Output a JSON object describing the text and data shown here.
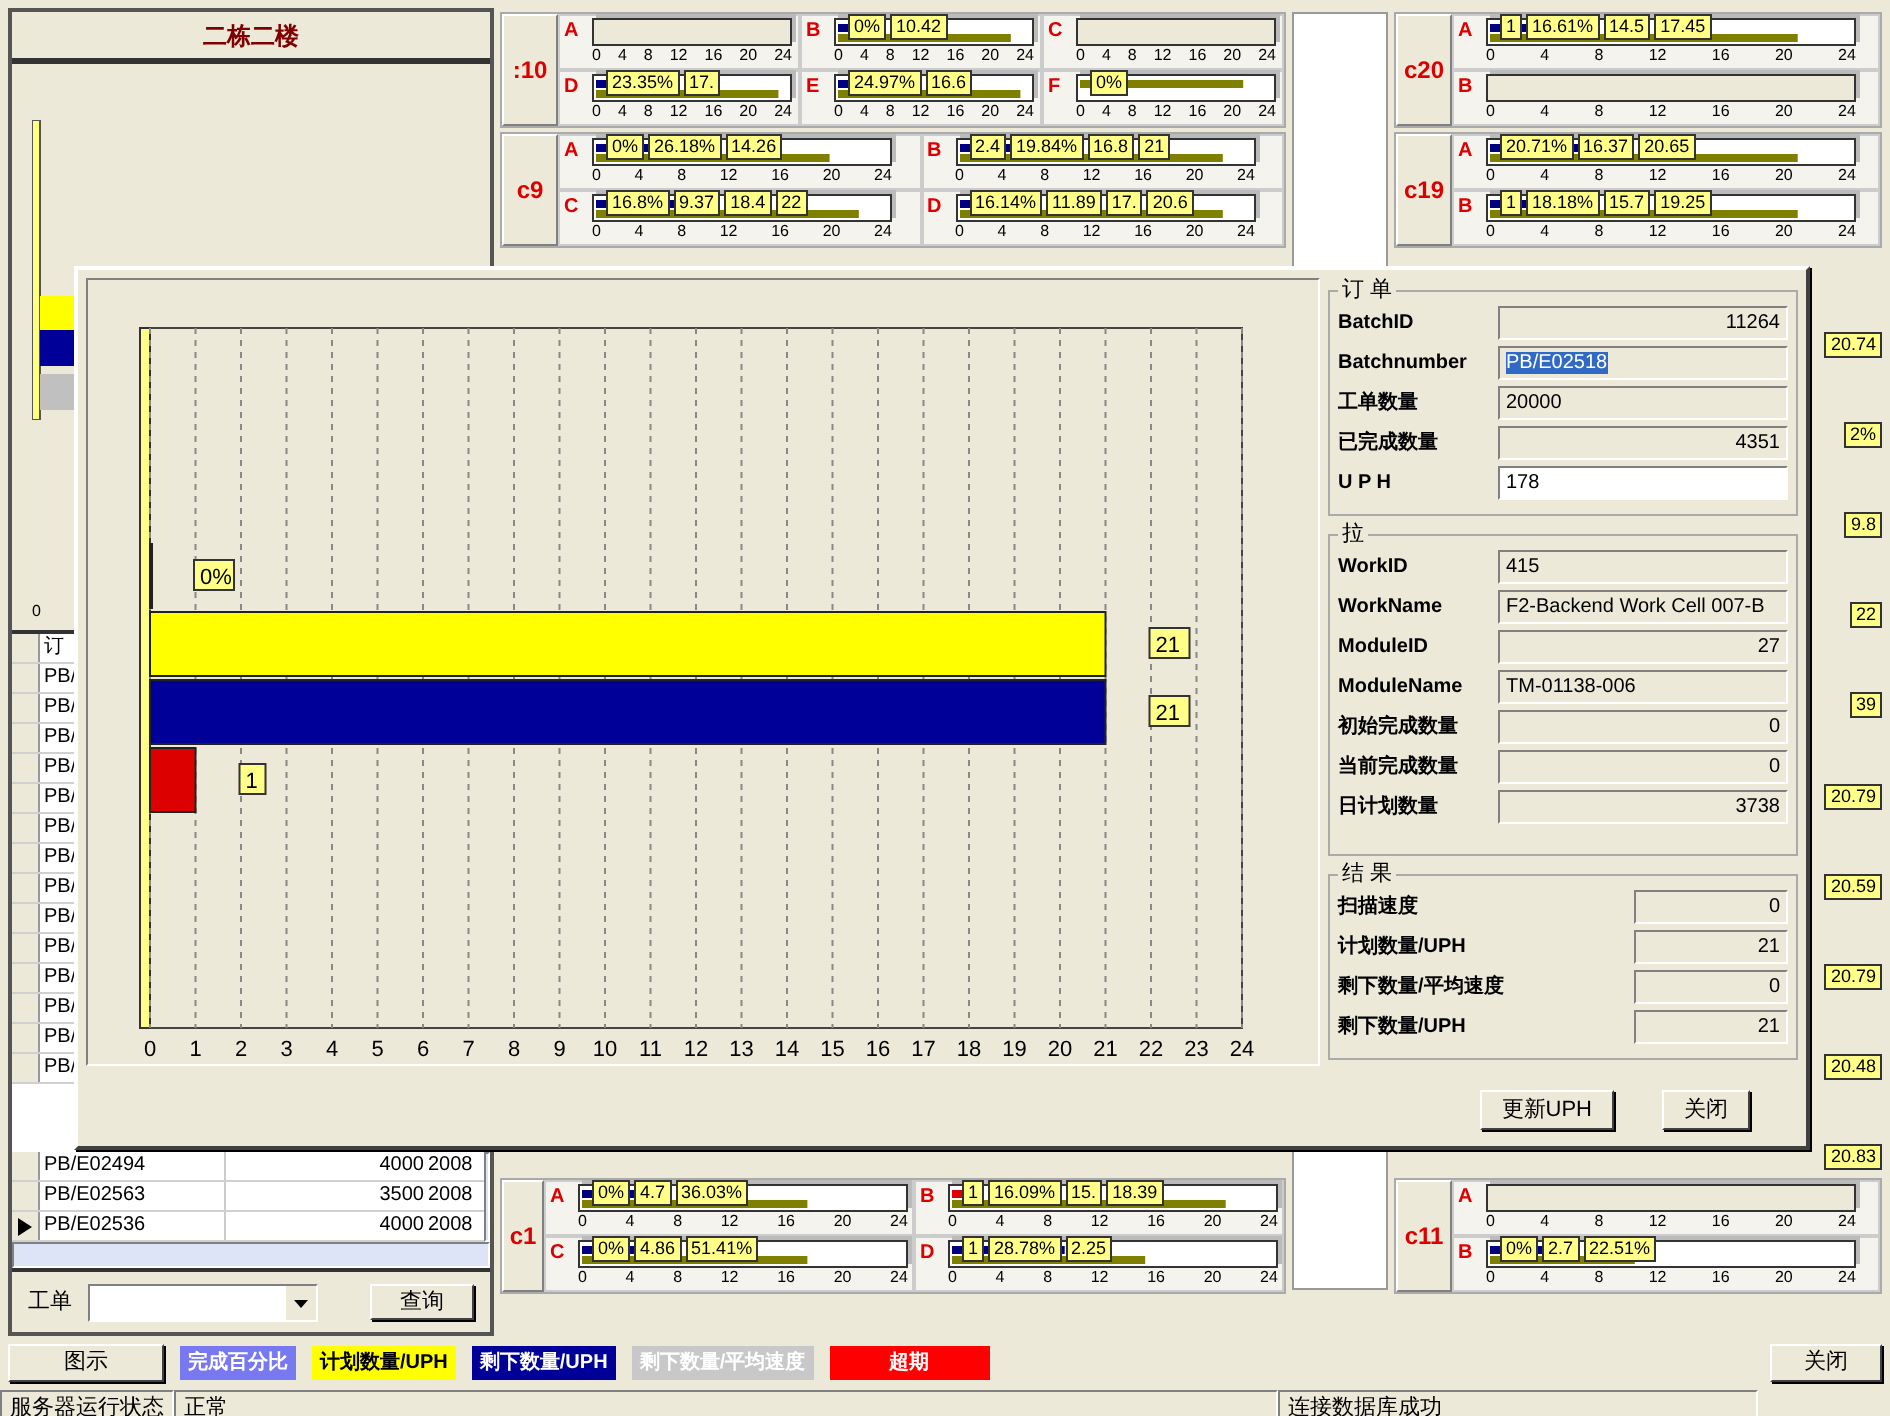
{
  "left_panel": {
    "title": "二栋二楼",
    "chart_tick": "0",
    "table": {
      "header": "订",
      "covered_rows": [
        "PB/",
        "PB/",
        "PB/",
        "PB/",
        "PB/",
        "PB/",
        "PB/",
        "PB/",
        "PB/",
        "PB/",
        "PB/",
        "PB/",
        "PB/",
        "PB/"
      ],
      "rows": [
        {
          "order": "PB/E02494",
          "qty": "4000",
          "date": "2008",
          "selected": false
        },
        {
          "order": "PB/E02563",
          "qty": "3500",
          "date": "2008",
          "selected": false
        },
        {
          "order": "PB/E02536",
          "qty": "4000",
          "date": "2008",
          "selected": true
        }
      ]
    },
    "query": {
      "label": "工单",
      "button": "查询"
    }
  },
  "middle_top": [
    {
      "name": ":10",
      "rows": [
        [
          {
            "letter": "A",
            "ticks": [
              "0",
              "4",
              "8",
              "12",
              "16",
              "20",
              "24"
            ]
          },
          {
            "letter": "B",
            "bars": [
              {
                "color": "#000080",
                "level": 0.25
              },
              {
                "color": "#808000",
                "level": 0.9
              }
            ],
            "labels": [
              "0%",
              "10.42"
            ],
            "ticks": [
              "0",
              "4",
              "8",
              "12",
              "16",
              "20",
              "24"
            ]
          },
          {
            "letter": "C",
            "ticks": [
              "0",
              "4",
              "8",
              "12",
              "16",
              "20",
              "24"
            ]
          }
        ],
        [
          {
            "letter": "D",
            "bars": [
              {
                "color": "#000080",
                "level": 0.35
              },
              {
                "color": "#808000",
                "level": 0.95
              }
            ],
            "labels": [
              "23.35%",
              "17."
            ],
            "ticks": [
              "0",
              "4",
              "8",
              "12",
              "16",
              "20",
              "24"
            ]
          },
          {
            "letter": "E",
            "bars": [
              {
                "color": "#000080",
                "level": 0.4
              },
              {
                "color": "#808000",
                "level": 0.95
              }
            ],
            "labels": [
              "24.97%",
              "16.6"
            ],
            "ticks": [
              "0",
              "4",
              "8",
              "12",
              "16",
              "20",
              "24"
            ]
          },
          {
            "letter": "F",
            "bars": [
              {
                "color": "#808000",
                "level": 0.85
              }
            ],
            "labels": [
              "0%"
            ],
            "ticks": [
              "0",
              "4",
              "8",
              "12",
              "16",
              "20",
              "24"
            ]
          }
        ]
      ]
    },
    {
      "name": "c9",
      "rows": [
        [
          {
            "letter": "A",
            "bars": [
              {
                "color": "#000080",
                "level": 0.2
              },
              {
                "color": "#808000",
                "level": 0.8
              }
            ],
            "labels": [
              "0%",
              "26.18%",
              "14.26"
            ],
            "ticks": [
              "0",
              "4",
              "8",
              "12",
              "16",
              "20",
              "24"
            ]
          },
          {
            "letter": "B",
            "bars": [
              {
                "color": "#000080",
                "level": 0.3
              },
              {
                "color": "#808000",
                "level": 0.9
              }
            ],
            "labels": [
              "2.4",
              "19.84%",
              "16.8",
              "21"
            ],
            "ticks": [
              "0",
              "4",
              "8",
              "12",
              "16",
              "20",
              "24"
            ]
          }
        ],
        [
          {
            "letter": "C",
            "bars": [
              {
                "color": "#000080",
                "level": 0.3
              },
              {
                "color": "#808000",
                "level": 0.9
              }
            ],
            "labels": [
              "16.8%",
              "9.37",
              "18.4",
              "22"
            ],
            "ticks": [
              "0",
              "4",
              "8",
              "12",
              "16",
              "20",
              "24"
            ]
          },
          {
            "letter": "D",
            "bars": [
              {
                "color": "#000080",
                "level": 0.25
              },
              {
                "color": "#808000",
                "level": 0.9
              }
            ],
            "labels": [
              "16.14%",
              "11.89",
              "17.",
              "20.6"
            ],
            "ticks": [
              "0",
              "4",
              "8",
              "12",
              "16",
              "20",
              "24"
            ]
          }
        ]
      ]
    }
  ],
  "middle_bottom": [
    {
      "name": "c1",
      "rows": [
        [
          {
            "letter": "A",
            "bars": [
              {
                "color": "#000080",
                "level": 0.2
              },
              {
                "color": "#808000",
                "level": 0.7
              }
            ],
            "labels": [
              "0%",
              "4.7",
              "36.03%"
            ],
            "ticks": [
              "0",
              "4",
              "8",
              "12",
              "16",
              "20",
              "24"
            ]
          },
          {
            "letter": "B",
            "bars": [
              {
                "color": "#dd0000",
                "level": 0.05
              },
              {
                "color": "#808000",
                "level": 0.85
              }
            ],
            "labels": [
              "1",
              "16.09%",
              "15.",
              "18.39"
            ],
            "ticks": [
              "0",
              "4",
              "8",
              "12",
              "16",
              "20",
              "24"
            ]
          }
        ],
        [
          {
            "letter": "C",
            "bars": [
              {
                "color": "#000080",
                "level": 0.2
              },
              {
                "color": "#808000",
                "level": 0.7
              }
            ],
            "labels": [
              "0%",
              "4.86",
              "51.41%"
            ],
            "ticks": [
              "0",
              "4",
              "8",
              "12",
              "16",
              "20",
              "24"
            ]
          },
          {
            "letter": "D",
            "bars": [
              {
                "color": "#000080",
                "level": 0.35
              },
              {
                "color": "#808000",
                "level": 0.6
              }
            ],
            "labels": [
              "1",
              "28.78%",
              "2.25"
            ],
            "ticks": [
              "0",
              "4",
              "8",
              "12",
              "16",
              "20",
              "24"
            ]
          }
        ]
      ]
    }
  ],
  "right_top": [
    {
      "name": "c20",
      "rows": [
        [
          {
            "letter": "A",
            "bars": [
              {
                "color": "#000080",
                "level": 0.3
              },
              {
                "color": "#808000",
                "level": 0.85
              }
            ],
            "labels": [
              "1",
              "16.61%",
              "14.5",
              "17.45"
            ],
            "ticks": [
              "0",
              "4",
              "8",
              "12",
              "16",
              "20",
              "24"
            ]
          }
        ],
        [
          {
            "letter": "B",
            "ticks": [
              "0",
              "4",
              "8",
              "12",
              "16",
              "20",
              "24"
            ]
          }
        ]
      ]
    },
    {
      "name": "c19",
      "rows": [
        [
          {
            "letter": "A",
            "bars": [
              {
                "color": "#000080",
                "level": 0.35
              },
              {
                "color": "#808000",
                "level": 0.85
              }
            ],
            "labels": [
              "20.71%",
              "16.37",
              "20.65"
            ],
            "ticks": [
              "0",
              "4",
              "8",
              "12",
              "16",
              "20",
              "24"
            ]
          }
        ],
        [
          {
            "letter": "B",
            "bars": [
              {
                "color": "#000080",
                "level": 0.3
              },
              {
                "color": "#808000",
                "level": 0.85
              }
            ],
            "labels": [
              "1",
              "18.18%",
              "15.7",
              "19.25"
            ],
            "ticks": [
              "0",
              "4",
              "8",
              "12",
              "16",
              "20",
              "24"
            ]
          }
        ]
      ]
    }
  ],
  "right_strip": [
    "20.74",
    "2%",
    "9.8",
    "22",
    "39",
    "20.79",
    "20.59",
    "20.79",
    "20.48",
    "20.83"
  ],
  "right_bottom": [
    {
      "name": "c11",
      "rows": [
        [
          {
            "letter": "A",
            "ticks": [
              "0",
              "4",
              "8",
              "12",
              "16",
              "20",
              "24"
            ]
          }
        ],
        [
          {
            "letter": "B",
            "bars": [
              {
                "color": "#000080",
                "level": 0.2
              },
              {
                "color": "#808000",
                "level": 0.4
              }
            ],
            "labels": [
              "0%",
              "2.7",
              "22.51%"
            ],
            "ticks": [
              "0",
              "4",
              "8",
              "12",
              "16",
              "20",
              "24"
            ]
          }
        ]
      ]
    }
  ],
  "dialog": {
    "chart_data": {
      "type": "bar",
      "orientation": "horizontal",
      "grid": true,
      "xlim": [
        0,
        24
      ],
      "xticks": [
        0,
        1,
        2,
        3,
        4,
        5,
        6,
        7,
        8,
        9,
        10,
        11,
        12,
        13,
        14,
        15,
        16,
        17,
        18,
        19,
        20,
        21,
        22,
        23,
        24
      ],
      "series": [
        {
          "color": "#000099",
          "values": [
            0
          ]
        },
        {
          "color": "#ffff00",
          "values": [
            21
          ]
        },
        {
          "color": "#000099",
          "values": [
            21
          ]
        },
        {
          "color": "#dd0000",
          "values": [
            1
          ]
        }
      ],
      "value_labels": [
        "0%",
        "21",
        "21",
        "1"
      ]
    },
    "groups": [
      {
        "title": "订 单",
        "kind": "narrow",
        "fields": [
          {
            "label": "BatchID",
            "value": "11264",
            "kind": "number",
            "highlighted": false,
            "editable": false
          },
          {
            "label": "Batchnumber",
            "value": "PB/E02518",
            "kind": "text",
            "highlighted": true,
            "editable": false
          },
          {
            "label": "工单数量",
            "value": "20000",
            "kind": "text",
            "highlighted": false,
            "editable": false
          },
          {
            "label": "已完成数量",
            "value": "4351",
            "kind": "number",
            "highlighted": false,
            "editable": false
          },
          {
            "label": "U P H",
            "value": "178",
            "kind": "text",
            "highlighted": false,
            "editable": true
          }
        ]
      },
      {
        "title": "拉",
        "kind": "narrow",
        "fields": [
          {
            "label": "WorkID",
            "value": "415",
            "kind": "text",
            "highlighted": false,
            "editable": false
          },
          {
            "label": "WorkName",
            "value": "F2-Backend Work Cell 007-B",
            "kind": "text",
            "highlighted": false,
            "editable": false
          },
          {
            "label": "ModuleID",
            "value": "27",
            "kind": "number",
            "highlighted": false,
            "editable": false
          },
          {
            "label": "ModuleName",
            "value": "TM-01138-006",
            "kind": "text",
            "highlighted": false,
            "editable": false
          },
          {
            "label": "初始完成数量",
            "value": "0",
            "kind": "number",
            "highlighted": false,
            "editable": false
          },
          {
            "label": "当前完成数量",
            "value": "0",
            "kind": "number",
            "highlighted": false,
            "editable": false
          },
          {
            "label": "日计划数量",
            "value": "3738",
            "kind": "number",
            "highlighted": false,
            "editable": false
          }
        ]
      },
      {
        "title": "结 果",
        "kind": "wide",
        "fields": [
          {
            "label": "扫描速度",
            "value": "0",
            "kind": "number",
            "highlighted": false,
            "editable": false
          },
          {
            "label": "计划数量/UPH",
            "value": "21",
            "kind": "number",
            "highlighted": false,
            "editable": false
          },
          {
            "label": "剩下数量/平均速度",
            "value": "0",
            "kind": "number",
            "highlighted": false,
            "editable": false
          },
          {
            "label": "剩下数量/UPH",
            "value": "21",
            "kind": "number",
            "highlighted": false,
            "editable": false
          }
        ]
      }
    ],
    "buttons": [
      "更新UPH",
      "关闭"
    ]
  },
  "legend": {
    "title": "图示",
    "items": [
      {
        "label": "完成百分比",
        "color": "#7878f0"
      },
      {
        "label": "计划数量/UPH",
        "color": "#ffff00"
      },
      {
        "label": "剩下数量/UPH",
        "color": "#000099"
      },
      {
        "label": "剩下数量/平均速度",
        "color": "#c8c8c8"
      },
      {
        "label": "超期",
        "color": "#ff0000"
      }
    ],
    "close_button": "关闭"
  },
  "status_bar": [
    "服务器运行状态",
    "正常",
    "连接数据库成功"
  ]
}
